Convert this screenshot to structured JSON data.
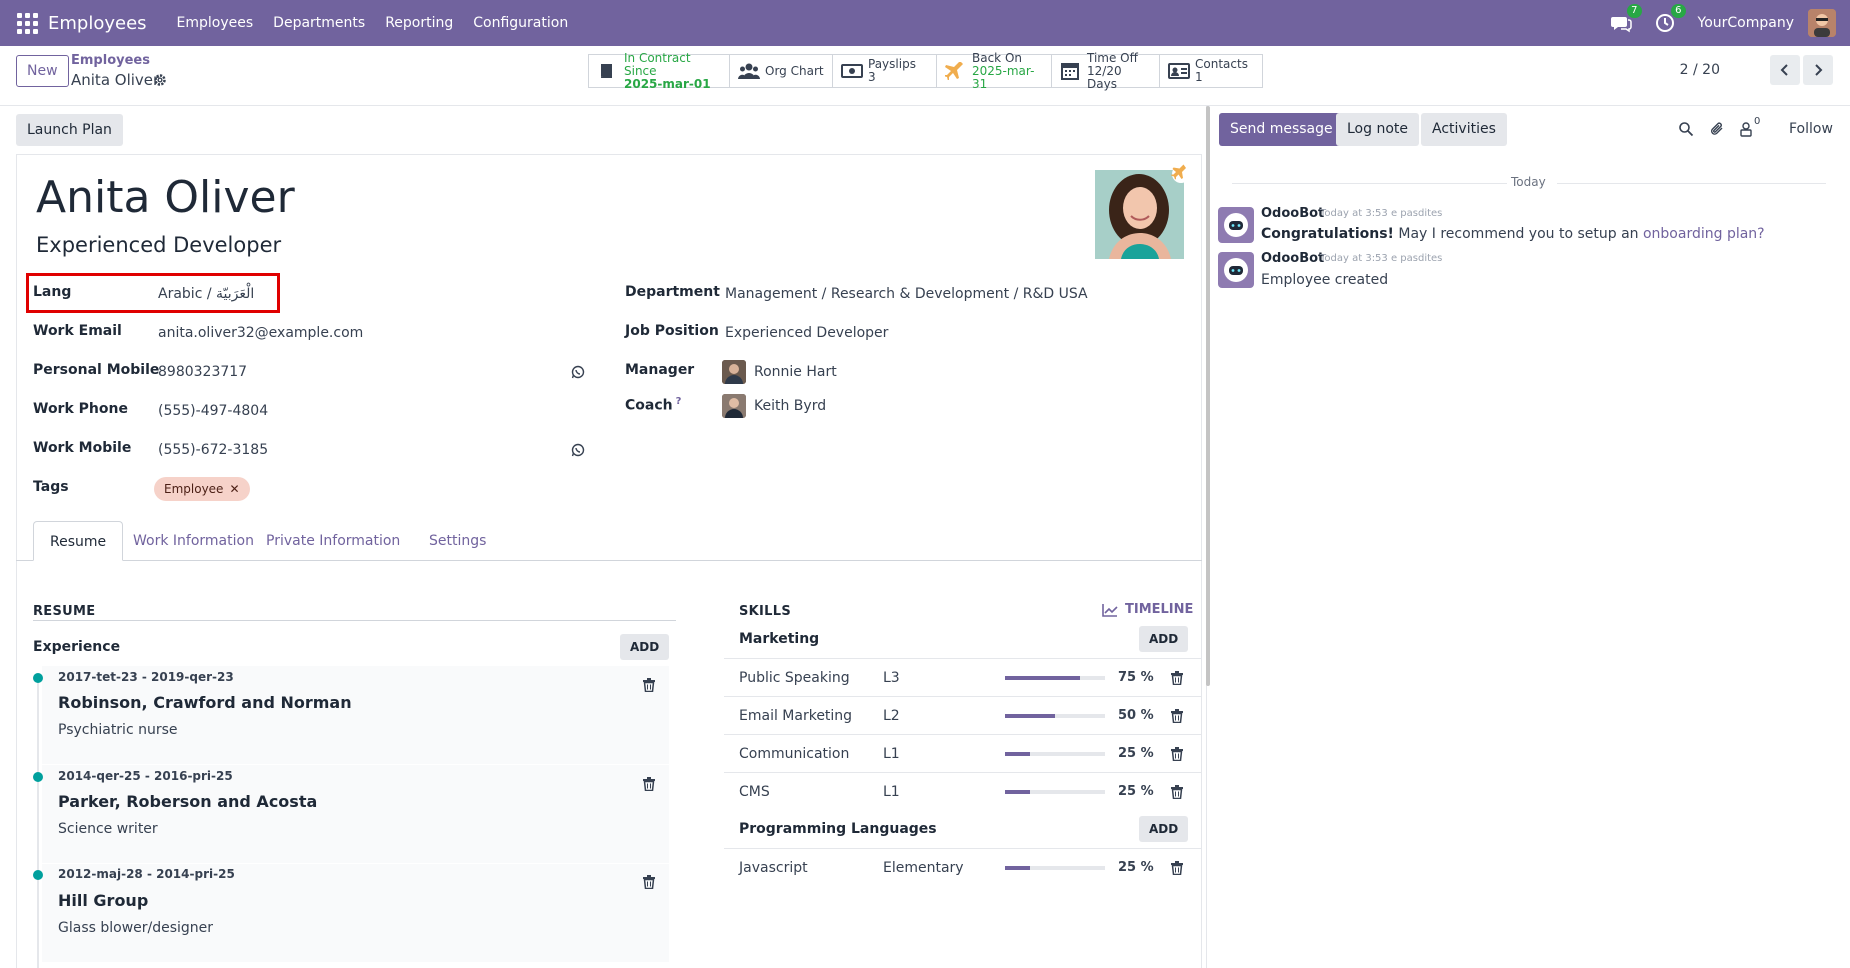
{
  "topbar": {
    "app_name": "Employees",
    "menu": [
      "Employees",
      "Departments",
      "Reporting",
      "Configuration"
    ],
    "messages_count": "7",
    "activities_count": "6",
    "company": "YourCompany"
  },
  "control": {
    "new_label": "New",
    "breadcrumb_parent": "Employees",
    "breadcrumb_current": "Anita Oliver",
    "pager": "2 / 20",
    "smart_buttons": {
      "contract": {
        "line1": "In Contract Since",
        "line2": "2025-mar-01"
      },
      "org_chart": {
        "line1": "Org Chart"
      },
      "payslips": {
        "line1": "Payslips",
        "line2": "3"
      },
      "back_on": {
        "line1": "Back On",
        "line2": "2025-mar-31"
      },
      "time_off": {
        "line1": "Time Off",
        "line2": "12/20 Days"
      },
      "contacts": {
        "line1": "Contacts",
        "line2": "1"
      }
    }
  },
  "form": {
    "launch_plan_label": "Launch Plan",
    "name": "Anita Oliver",
    "job_title": "Experienced Developer",
    "fields": {
      "lang": {
        "label": "Lang",
        "value": "Arabic / الْعَرَبيّة"
      },
      "work_email": {
        "label": "Work Email",
        "value": "anita.oliver32@example.com"
      },
      "personal_mobile": {
        "label": "Personal Mobile",
        "value": "8980323717"
      },
      "work_phone": {
        "label": "Work Phone",
        "value": "(555)-497-4804"
      },
      "work_mobile": {
        "label": "Work Mobile",
        "value": "(555)-672-3185"
      },
      "tags": {
        "label": "Tags",
        "value": "Employee"
      },
      "department": {
        "label": "Department",
        "value": "Management / Research & Development / R&D USA"
      },
      "job_position": {
        "label": "Job Position",
        "value": "Experienced Developer"
      },
      "manager": {
        "label": "Manager",
        "value": "Ronnie Hart"
      },
      "coach": {
        "label": "Coach",
        "value": "Keith Byrd",
        "help": "?"
      }
    },
    "tabs": [
      "Resume",
      "Work Information",
      "Private Information",
      "Settings"
    ]
  },
  "resume": {
    "title": "RESUME",
    "experience_label": "Experience",
    "add_label": "ADD",
    "items": [
      {
        "dates": "2017-tet-23 - 2019-qer-23",
        "name": "Robinson, Crawford and Norman",
        "desc": "Psychiatric nurse"
      },
      {
        "dates": "2014-qer-25 - 2016-pri-25",
        "name": "Parker, Roberson and Acosta",
        "desc": "Science writer"
      },
      {
        "dates": "2012-maj-28 - 2014-pri-25",
        "name": "Hill Group",
        "desc": "Glass blower/designer"
      }
    ]
  },
  "skills": {
    "title": "SKILLS",
    "timeline_label": "TIMELINE",
    "add_label": "ADD",
    "categories": [
      {
        "name": "Marketing",
        "rows": [
          {
            "name": "Public Speaking",
            "level": "L3",
            "progress": 75,
            "pct": "75 %"
          },
          {
            "name": "Email Marketing",
            "level": "L2",
            "progress": 50,
            "pct": "50 %"
          },
          {
            "name": "Communication",
            "level": "L1",
            "progress": 25,
            "pct": "25 %"
          },
          {
            "name": "CMS",
            "level": "L1",
            "progress": 25,
            "pct": "25 %"
          }
        ]
      },
      {
        "name": "Programming Languages",
        "rows": [
          {
            "name": "Javascript",
            "level": "Elementary",
            "progress": 25,
            "pct": "25 %"
          }
        ]
      }
    ]
  },
  "chatter": {
    "send_message": "Send message",
    "log_note": "Log note",
    "activities": "Activities",
    "followers_count": "0",
    "follow": "Follow",
    "today": "Today",
    "messages": [
      {
        "author": "OdooBot",
        "time": "Today at 3:53 e pasdites",
        "strong": "Congratulations!",
        "body": " May I recommend you to setup an ",
        "link": "onboarding plan?"
      },
      {
        "author": "OdooBot",
        "time": "Today at 3:53 e pasdites",
        "body": "Employee created"
      }
    ]
  },
  "colors": {
    "brand": "#71639e",
    "accent": "#00a09d",
    "success": "#28a745",
    "highlight": "#e00000"
  }
}
